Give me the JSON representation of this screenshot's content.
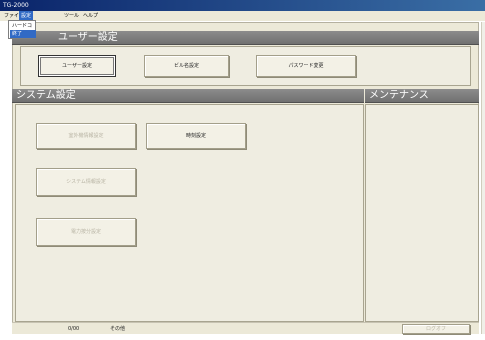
{
  "window": {
    "title": "TG-2000"
  },
  "menu": {
    "items": [
      "ファイル",
      "設定",
      "ツール",
      "ヘルプ"
    ],
    "active_index": 1,
    "dropdown": {
      "items": [
        "ハードコピー",
        "終了"
      ],
      "selected_index": 1
    }
  },
  "user_settings": {
    "header": "ユーザー設定",
    "buttons": {
      "user": "ユーザー設定",
      "building": "ビル名設定",
      "password": "パスワード変更"
    }
  },
  "system_settings": {
    "header": "システム設定",
    "buttons": {
      "outdoor_unit": "室外機情報設定",
      "time": "時刻設定",
      "system_info": "システム情報設定",
      "power_distribution": "電力按分設定"
    }
  },
  "maintenance": {
    "header": "メンテナンス"
  },
  "status": {
    "left": "0/00",
    "middle": "その他",
    "right": "ログオフ"
  },
  "colors": {
    "title_bar": "#0a246a",
    "menu_highlight": "#316ac5",
    "section_header": "#7a7a7a",
    "panel_bg": "#efede1"
  }
}
